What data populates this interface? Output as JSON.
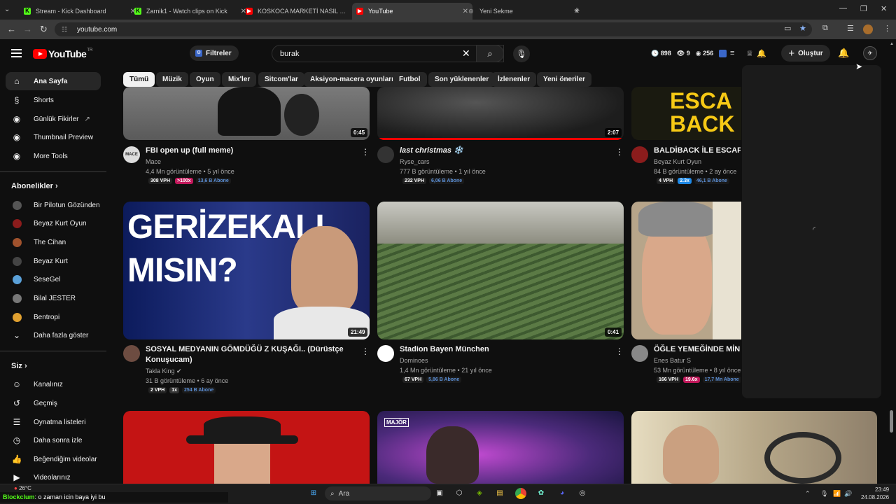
{
  "browser": {
    "tabs": [
      {
        "title": "Stream - Kick Dashboard",
        "favicon": "K",
        "color": "#53fc18"
      },
      {
        "title": "Zarnik1 - Watch clips on Kick",
        "favicon": "K",
        "color": "#53fc18"
      },
      {
        "title": "KOSKOCA MARKETİ NASIL BATI",
        "favicon": "▶",
        "color": "#ff0000"
      },
      {
        "title": "YouTube",
        "favicon": "▶",
        "color": "#ff0000"
      },
      {
        "title": "Yeni Sekme",
        "favicon": "◎",
        "color": "#999999"
      }
    ],
    "new_tab_icon": "+",
    "url": "youtube.com"
  },
  "header": {
    "logo_text": "YouTube",
    "logo_super": "TR",
    "filter_label": "Filtreler",
    "search_value": "burak",
    "stats": [
      {
        "icon": "clock-icon",
        "glyph": "🕓",
        "value": "898"
      },
      {
        "icon": "eye-icon",
        "glyph": "👁",
        "value": "9"
      },
      {
        "icon": "eye-icon",
        "glyph": "◉",
        "value": "256"
      }
    ],
    "create_label": "Oluştur"
  },
  "chips": [
    "Tümü",
    "Müzik",
    "Oyun",
    "Mix'ler",
    "Sitcom'lar",
    "Aksiyon-macera oyunları",
    "Futbol",
    "Son yüklenenler",
    "İzlenenler",
    "Yeni öneriler"
  ],
  "sidebar": {
    "main": [
      {
        "label": "Ana Sayfa",
        "icon": "home-icon",
        "glyph": "⌂"
      },
      {
        "label": "Shorts",
        "icon": "shorts-icon",
        "glyph": "§"
      },
      {
        "label": "Günlük Fikirler",
        "icon": "ideas-icon",
        "glyph": "◉",
        "ext": "↗"
      },
      {
        "label": "Thumbnail Preview",
        "icon": "preview-icon",
        "glyph": "◉"
      },
      {
        "label": "More Tools",
        "icon": "tools-icon",
        "glyph": "◉"
      }
    ],
    "subs_header": "Abonelikler",
    "subs": [
      {
        "label": "Bir Pilotun Gözünden",
        "color": "#555555"
      },
      {
        "label": "Beyaz Kurt Oyun",
        "color": "#8b1c1c"
      },
      {
        "label": "The Cihan",
        "color": "#a0522d"
      },
      {
        "label": "Beyaz Kurt",
        "color": "#444444"
      },
      {
        "label": "SeseGel",
        "color": "#5aa0d8"
      },
      {
        "label": "Bilal JESTER",
        "color": "#777777"
      },
      {
        "label": "Bentropi",
        "color": "#e0a030"
      }
    ],
    "more_label": "Daha fazla göster",
    "you_header": "Siz",
    "you": [
      {
        "label": "Kanalınız",
        "icon": "channel-icon",
        "glyph": "☺"
      },
      {
        "label": "Geçmiş",
        "icon": "history-icon",
        "glyph": "↺"
      },
      {
        "label": "Oynatma listeleri",
        "icon": "playlist-icon",
        "glyph": "☰"
      },
      {
        "label": "Daha sonra izle",
        "icon": "watch-later-icon",
        "glyph": "◷"
      },
      {
        "label": "Beğendiğim videolar",
        "icon": "like-icon",
        "glyph": "👍"
      },
      {
        "label": "Videolarınız",
        "icon": "your-videos-icon",
        "glyph": "▶"
      }
    ]
  },
  "videos_row1": [
    {
      "title": "FBI open up (full meme)",
      "channel": "Mace",
      "meta": "4,4 Mn görüntüleme • 5 yıl önce",
      "duration": "0:45",
      "vph": "308 VPH",
      "mult": ">100x",
      "mult_color": "#c2185b",
      "subs": "13,6 B Abone",
      "avatar_text": "MACE",
      "avatar_color": "#dddddd"
    },
    {
      "title": "last christmas ❄️",
      "channel": "Ryse_cars",
      "meta": "777 B görüntüleme • 1 yıl önce",
      "duration": "2:07",
      "vph": "232 VPH",
      "mult": "",
      "mult_color": "",
      "subs": "6,06 B Abone",
      "avatar_text": "",
      "avatar_color": "#333333"
    },
    {
      "title": "BALDİBACK İLE ESCAPE T",
      "channel": "Beyaz Kurt Oyun",
      "meta": "84 B görüntüleme • 2 ay önce",
      "duration": "",
      "vph": "4 VPH",
      "mult": "2.3x",
      "mult_color": "#1e88e5",
      "subs": "46,1 B Abone",
      "avatar_text": "",
      "avatar_color": "#8b1c1c",
      "thumb_text": "ESCA BACK"
    }
  ],
  "videos_row2": [
    {
      "title": "SOSYAL MEDYANIN GÖMDÜĞÜ Z KUŞAĞI.. (Dürüstçe Konuşucam)",
      "channel": "Takla King",
      "verified": "✔",
      "meta": "31 B görüntüleme • 6 ay önce",
      "duration": "21:49",
      "vph": "2 VPH",
      "mult": "1x",
      "mult_color": "#333333",
      "subs": "254 B Abone",
      "avatar_color": "#6d4c41",
      "thumb_text": "GERİZEKALI MISIN?"
    },
    {
      "title": "Stadion Bayen München",
      "channel": "Dominoes",
      "verified": "",
      "meta": "1,4 Mn görüntüleme • 21 yıl önce",
      "duration": "0:41",
      "vph": "67 VPH",
      "mult": "",
      "mult_color": "",
      "subs": "5,86 B Abone",
      "avatar_color": "#ffffff",
      "thumb_text": ""
    },
    {
      "title": "ÖĞLE YEMEĞİNDE MİNEC",
      "channel": "Enes Batur S",
      "verified": "",
      "meta": "53 Mn görüntüleme • 8 yıl önce",
      "duration": "",
      "vph": "166 VPH",
      "mult": "19.6x",
      "mult_color": "#c2185b",
      "subs": "17,7 Mn Abone",
      "avatar_color": "#888888",
      "thumb_text": ""
    }
  ],
  "row3_logo": "MAJÖR",
  "taskbar": {
    "weather": "26°C",
    "search_placeholder": "Ara",
    "time": "23:49",
    "date": "24.08.2026",
    "ticker_user": "Blockclum",
    "ticker_text": ": o zaman icin baya iyi bu"
  }
}
